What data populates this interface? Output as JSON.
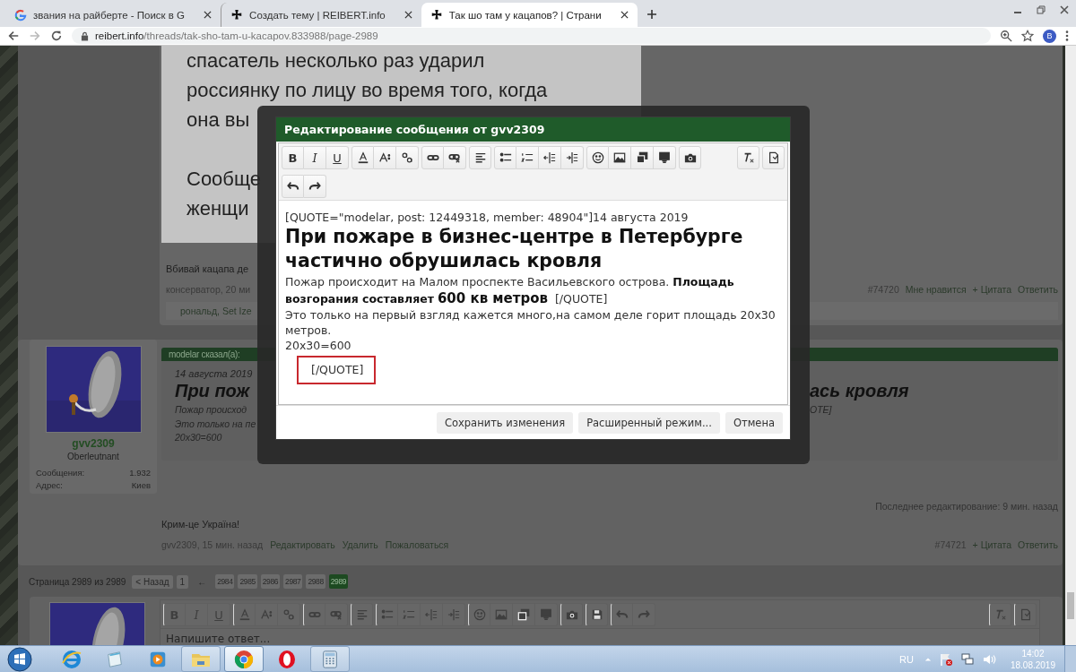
{
  "browser": {
    "tabs": [
      {
        "kind": "google",
        "title": "звания на райберте - Поиск в G",
        "selected": false
      },
      {
        "kind": "cross",
        "title": "Создать тему | REIBERT.info",
        "selected": false
      },
      {
        "kind": "cross",
        "title": "Так шо там у кацапов? | Страни",
        "selected": true
      }
    ],
    "url": {
      "host": "reibert.info",
      "path": "/threads/tak-sho-tam-u-kacapov.833988/page-2989"
    },
    "profile": "B"
  },
  "post_1": {
    "screenshot_lines": [
      "спасатель несколько раз ударил",
      "россиянку по лицу во время того, когда",
      "она вы"
    ],
    "screenshot_lines_2": [
      "Сообще",
      "женщи"
    ],
    "text": "Вбивай кацапа де",
    "meta": "консерватор, 20 ми",
    "actions": [
      "#74720",
      "Мне нравится",
      "+ Цитата",
      "Ответить"
    ],
    "likes": "рональд, Set Ize"
  },
  "post_2": {
    "user": {
      "name": "gvv2309",
      "rank": "Oberleutnant",
      "stats": [
        {
          "label": "Сообщения:",
          "value": "1.932"
        },
        {
          "label": "Адрес:",
          "value": "Киев"
        }
      ]
    },
    "quote": {
      "header": "modelar сказал(а):",
      "date": "14 августа 2019",
      "title": "При пож",
      "title_end": "ась кровля",
      "lines": [
        "Пожар происход",
        "Это только на пе",
        "20x30=600"
      ],
      "line_end": "OTE]"
    },
    "edited": "Последнее редактирование: 9 мин. назад",
    "text": "Крим-це Україна!",
    "meta": "gvv2309, 15 мин. назад",
    "links": [
      "Редактировать",
      "Удалить",
      "Пожаловаться"
    ],
    "actions": [
      "#74721",
      "+ Цитата",
      "Ответить"
    ]
  },
  "pagination": {
    "label": "Страница 2989 из 2989",
    "prev": "< Назад",
    "first": "1",
    "skip": "←",
    "pages": [
      {
        "label": "2984",
        "selected": false
      },
      {
        "label": "2985",
        "selected": false
      },
      {
        "label": "2986",
        "selected": false
      },
      {
        "label": "2987",
        "selected": false
      },
      {
        "label": "2988",
        "selected": false
      },
      {
        "label": "2989",
        "selected": true
      }
    ]
  },
  "reply": {
    "format_buttons": [
      "B",
      "I",
      "U"
    ],
    "placeholder": "Напишите ответ..."
  },
  "dialog": {
    "title": "Редактирование сообщения от gvv2309",
    "format_buttons": [
      "B",
      "I",
      "U"
    ],
    "quote_open": "[QUOTE=\"modelar, post: 12449318, member: 48904\"]14 августа 2019",
    "heading": "При пожаре в бизнес-центре в Петербурге частично обрушилась кровля",
    "paragraph": {
      "text": "Пожар происходит на Малом проспекте Васильевского острова. **Площадь возгорания составляет**",
      "emphasis": "600 кв метров",
      "tag": "[/QUOTE]"
    },
    "lines": [
      "Это только на первый взгляд кажется много,на самом деле горит площадь 20x30 метров.",
      "20x30=600"
    ],
    "closing_tag": {
      "text": "[/QUOTE]",
      "highlighted": true
    },
    "buttons": [
      "Сохранить изменения",
      "Расширенный режим...",
      "Отмена"
    ]
  },
  "taskbar": {
    "apps": [
      {
        "kind": "ie",
        "open": false,
        "selected": false
      },
      {
        "kind": "notepad",
        "open": false,
        "selected": false
      },
      {
        "kind": "media",
        "open": false,
        "selected": false
      },
      {
        "kind": "explorer",
        "open": true,
        "selected": false
      },
      {
        "kind": "chrome",
        "open": true,
        "selected": true
      },
      {
        "kind": "opera",
        "open": false,
        "selected": false
      },
      {
        "kind": "calculator",
        "open": true,
        "selected": false
      }
    ],
    "language": "RU",
    "time": "14:02",
    "date": "18.08.2019"
  }
}
